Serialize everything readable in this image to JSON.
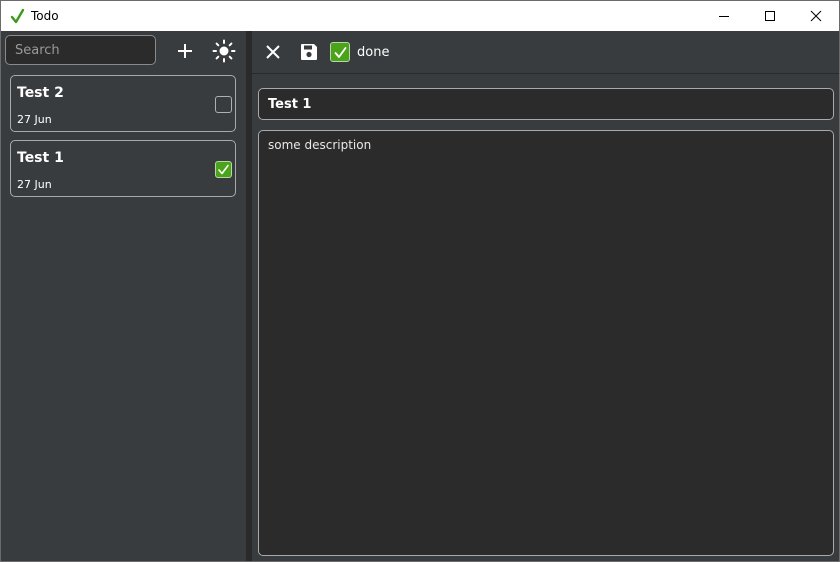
{
  "window": {
    "title": "Todo",
    "icon": "check-icon",
    "controls": [
      "minimize-icon",
      "maximize-icon",
      "close-icon"
    ],
    "accent_color": "#4aa31a"
  },
  "sidebar": {
    "search": {
      "value": "",
      "placeholder": "Search"
    },
    "add_icon": "plus-icon",
    "theme_icon": "sun-icon",
    "todos": [
      {
        "title": "Test 2",
        "date": "27 Jun",
        "done": false
      },
      {
        "title": "Test 1",
        "date": "27 Jun",
        "done": true
      }
    ]
  },
  "editor": {
    "toolbar": {
      "close_icon": "close-icon",
      "save_icon": "save-icon",
      "done_checked": true,
      "done_label": "done"
    },
    "title_value": "Test 1",
    "description_value": "some description"
  }
}
